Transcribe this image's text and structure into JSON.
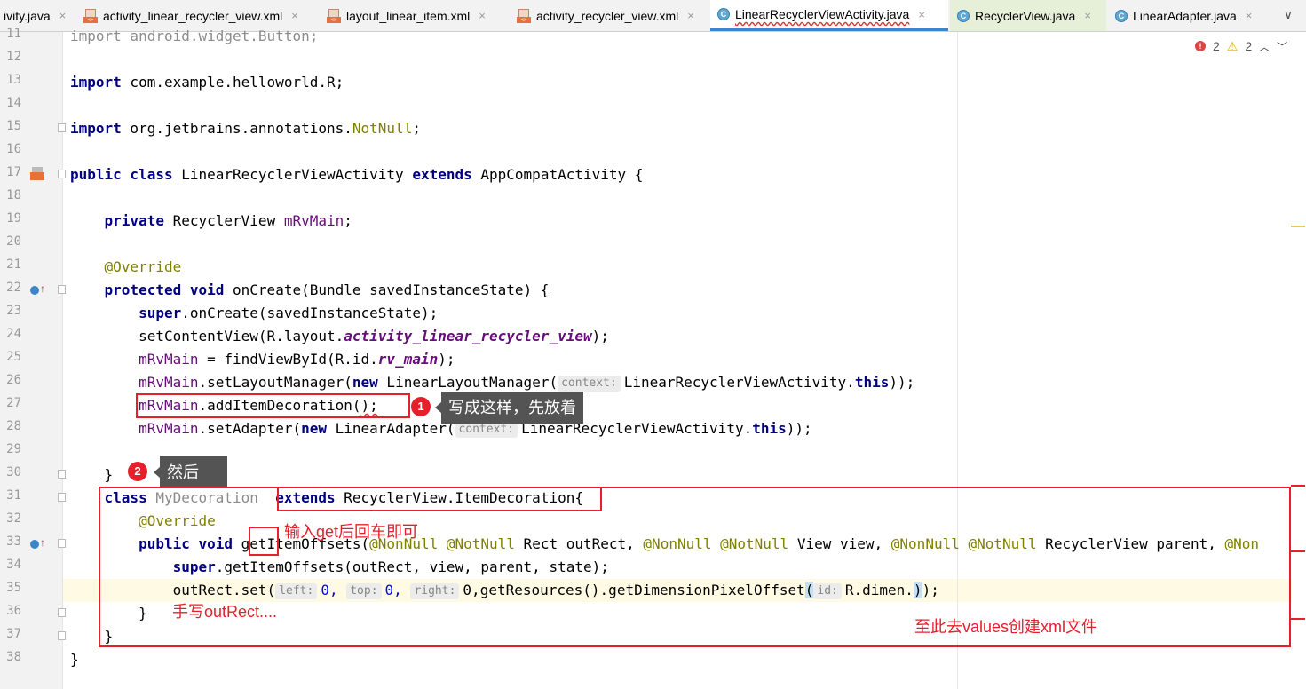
{
  "tabs": [
    {
      "label": "ivity.java",
      "icon": "class-icon",
      "left": 0
    },
    {
      "label": "activity_linear_recycler_view.xml",
      "icon": "xml-file-icon"
    },
    {
      "label": "layout_linear_item.xml",
      "icon": "xml-file-icon"
    },
    {
      "label": "activity_recycler_view.xml",
      "icon": "xml-file-icon"
    },
    {
      "label": "LinearRecyclerViewActivity.java",
      "icon": "class-icon",
      "active": true
    },
    {
      "label": "RecyclerView.java",
      "icon": "class-icon"
    },
    {
      "label": "LinearAdapter.java",
      "icon": "class-icon"
    }
  ],
  "tab_close": "×",
  "tab_menu": "∨",
  "inspections": {
    "errors": "2",
    "warnings": "2",
    "up": "︿",
    "down": "﹀",
    "error_glyph": "!",
    "warning_glyph": "⚠"
  },
  "line_numbers": [
    "11",
    "12",
    "13",
    "14",
    "15",
    "16",
    "17",
    "18",
    "19",
    "20",
    "21",
    "22",
    "23",
    "24",
    "25",
    "26",
    "27",
    "28",
    "29",
    "30",
    "31",
    "32",
    "33",
    "34",
    "35",
    "36",
    "37",
    "38"
  ],
  "code": {
    "l11": "import android.widget.Button;",
    "l13a": "import",
    "l13b": " com.example.helloworld.R;",
    "l15a": "import",
    "l15b": " org.jetbrains.annotations.",
    "l15c": "NotNull",
    "l15d": ";",
    "l17a": "public class",
    "l17b": " LinearRecyclerViewActivity ",
    "l17c": "extends",
    "l17d": " AppCompatActivity {",
    "l19a": "    private",
    "l19b": " RecyclerView ",
    "l19c": "mRvMain",
    "l19d": ";",
    "l21": "    @Override",
    "l22a": "    protected void",
    "l22b": " onCreate(Bundle savedInstanceState) {",
    "l23a": "        super",
    "l23b": ".onCreate(savedInstanceState);",
    "l24a": "        setContentView(R.layout.",
    "l24b": "activity_linear_recycler_view",
    "l24c": ");",
    "l25a": "        ",
    "l25b": "mRvMain",
    "l25c": " = findViewById(R.id.",
    "l25d": "rv_main",
    "l25e": ");",
    "l26a": "        ",
    "l26b": "mRvMain",
    "l26c": ".setLayoutManager(",
    "l26d": "new",
    "l26e": " LinearLayoutManager(",
    "l26hint": "context:",
    "l26f": "LinearRecyclerViewActivity.",
    "l26g": "this",
    "l26h": "));",
    "l27a": "        ",
    "l27b": "mRvMain",
    "l27c": ".addItemDecoration(",
    "l27d": ");",
    "l28a": "        ",
    "l28b": "mRvMain",
    "l28c": ".setAdapter(",
    "l28d": "new",
    "l28e": " LinearAdapter(",
    "l28hint": "context:",
    "l28f": "LinearRecyclerViewActivity.",
    "l28g": "this",
    "l28h": "));",
    "l30": "    }",
    "l31a": "    class",
    "l31b": " MyDecoration ",
    "l31c": " extends",
    "l31d": " RecyclerView.ItemDecoration{",
    "l32": "        @Override",
    "l33a": "        public void",
    "l33b": " getItemOffsets(",
    "l33c": "@NonNull @NotNull",
    "l33d": " Rect outRect, ",
    "l33e": "@NonNull @NotNull",
    "l33f": " View view, ",
    "l33g": "@NonNull @NotNull",
    "l33h": " RecyclerView parent, ",
    "l33i": "@Non",
    "l34a": "            super",
    "l34b": ".getItemOffsets(outRect, view, parent, state);",
    "l35a": "            outRect.set(",
    "l35h1": "left:",
    "l35b": "0, ",
    "l35h2": "top:",
    "l35c": "0, ",
    "l35h3": "right:",
    "l35d": "0,getResources().getDimensionPixelOffset",
    "l35e": "(",
    "l35h4": "id:",
    "l35f": "R.dimen.",
    "l35g": ")",
    "l35i": ");",
    "l36": "        }",
    "l37": "    }",
    "l38": "}"
  },
  "callouts": {
    "badge1": "1",
    "tip1": "写成这样，先放着",
    "badge2": "2",
    "tip2": "然后",
    "note_get": "输入get后回车即可",
    "note_outrect": "手写outRect....",
    "note_values": "至此去values创建xml文件"
  }
}
